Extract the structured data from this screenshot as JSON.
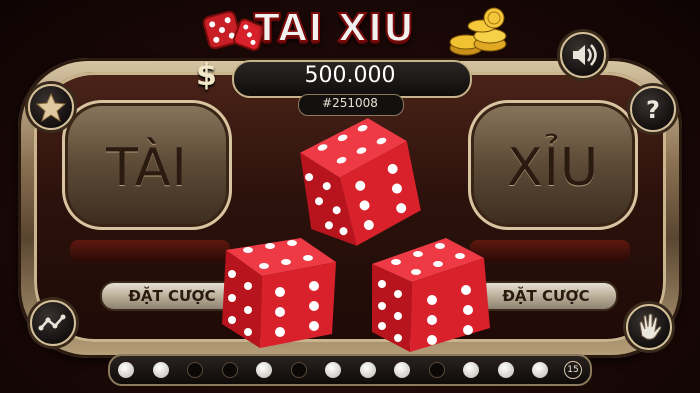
{
  "logo": {
    "title": "TAI XIU"
  },
  "balance": {
    "currency_symbol": "$",
    "value": "500.000"
  },
  "session": {
    "id": "#251008"
  },
  "panels": {
    "tai": {
      "label": "TÀI",
      "bet_label": "ĐẶT CƯỢC"
    },
    "xiu": {
      "label": "XỈU",
      "bet_label": "ĐẶT CƯỢC"
    }
  },
  "buttons": {
    "sound": "speaker-icon",
    "star": "star-icon",
    "help": "question-icon",
    "chart": "trend-icon",
    "hand": "hand-icon"
  },
  "dice": [
    {
      "name": "die-top",
      "face": 6
    },
    {
      "name": "die-left",
      "face": 6
    },
    {
      "name": "die-right",
      "face": 6
    }
  ],
  "history": {
    "results": [
      "white",
      "white",
      "dark",
      "dark",
      "white",
      "dark",
      "white",
      "white",
      "white",
      "dark",
      "white",
      "white",
      "white"
    ],
    "count": "15"
  },
  "colors": {
    "die_red": "#d8212b",
    "gold": "#c9b48d",
    "background": "#1a0a08"
  }
}
